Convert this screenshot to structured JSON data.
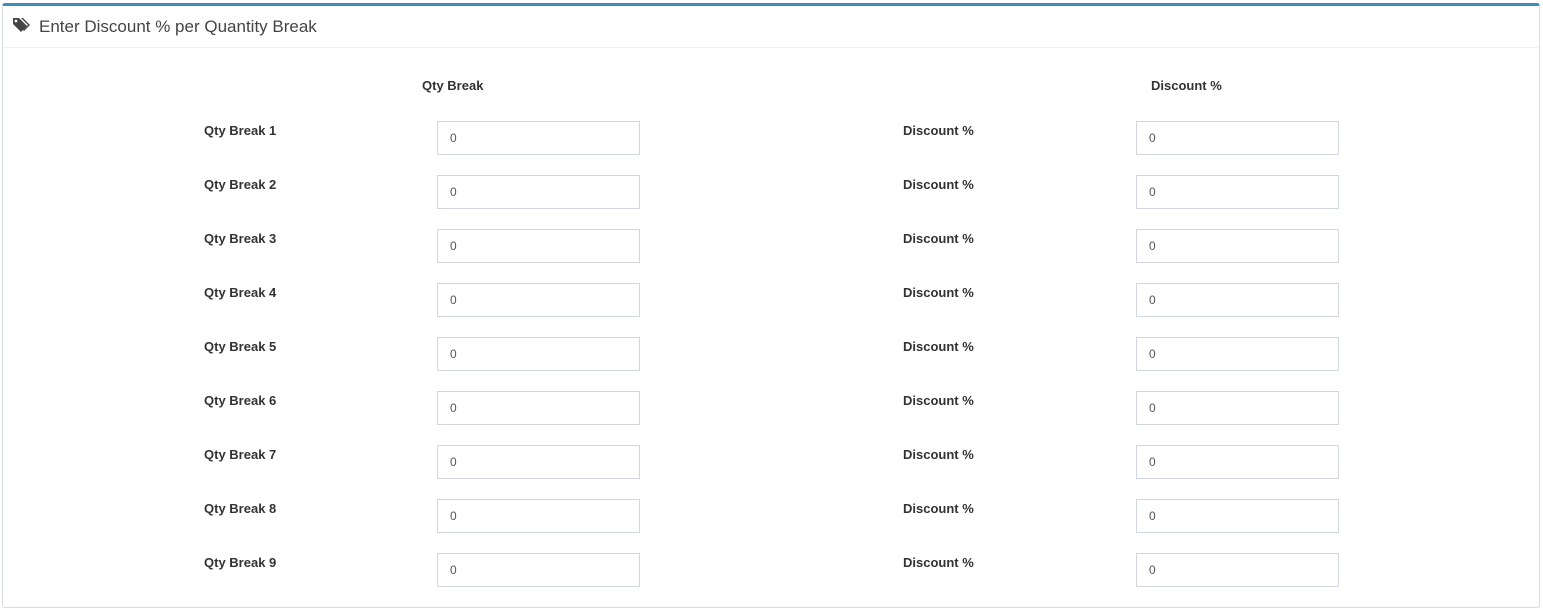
{
  "panel": {
    "title": "Enter Discount % per Quantity Break",
    "icon": "tags-icon",
    "accent_color": "#3c8dbc"
  },
  "columns": {
    "qty_header": "Qty Break",
    "discount_header": "Discount %"
  },
  "rows": [
    {
      "qty_label": "Qty Break 1",
      "qty_value": "0",
      "discount_label": "Discount %",
      "discount_value": "0"
    },
    {
      "qty_label": "Qty Break 2",
      "qty_value": "0",
      "discount_label": "Discount %",
      "discount_value": "0"
    },
    {
      "qty_label": "Qty Break 3",
      "qty_value": "0",
      "discount_label": "Discount %",
      "discount_value": "0"
    },
    {
      "qty_label": "Qty Break 4",
      "qty_value": "0",
      "discount_label": "Discount %",
      "discount_value": "0"
    },
    {
      "qty_label": "Qty Break 5",
      "qty_value": "0",
      "discount_label": "Discount %",
      "discount_value": "0"
    },
    {
      "qty_label": "Qty Break 6",
      "qty_value": "0",
      "discount_label": "Discount %",
      "discount_value": "0"
    },
    {
      "qty_label": "Qty Break 7",
      "qty_value": "0",
      "discount_label": "Discount %",
      "discount_value": "0"
    },
    {
      "qty_label": "Qty Break 8",
      "qty_value": "0",
      "discount_label": "Discount %",
      "discount_value": "0"
    },
    {
      "qty_label": "Qty Break 9",
      "qty_value": "0",
      "discount_label": "Discount %",
      "discount_value": "0"
    }
  ]
}
